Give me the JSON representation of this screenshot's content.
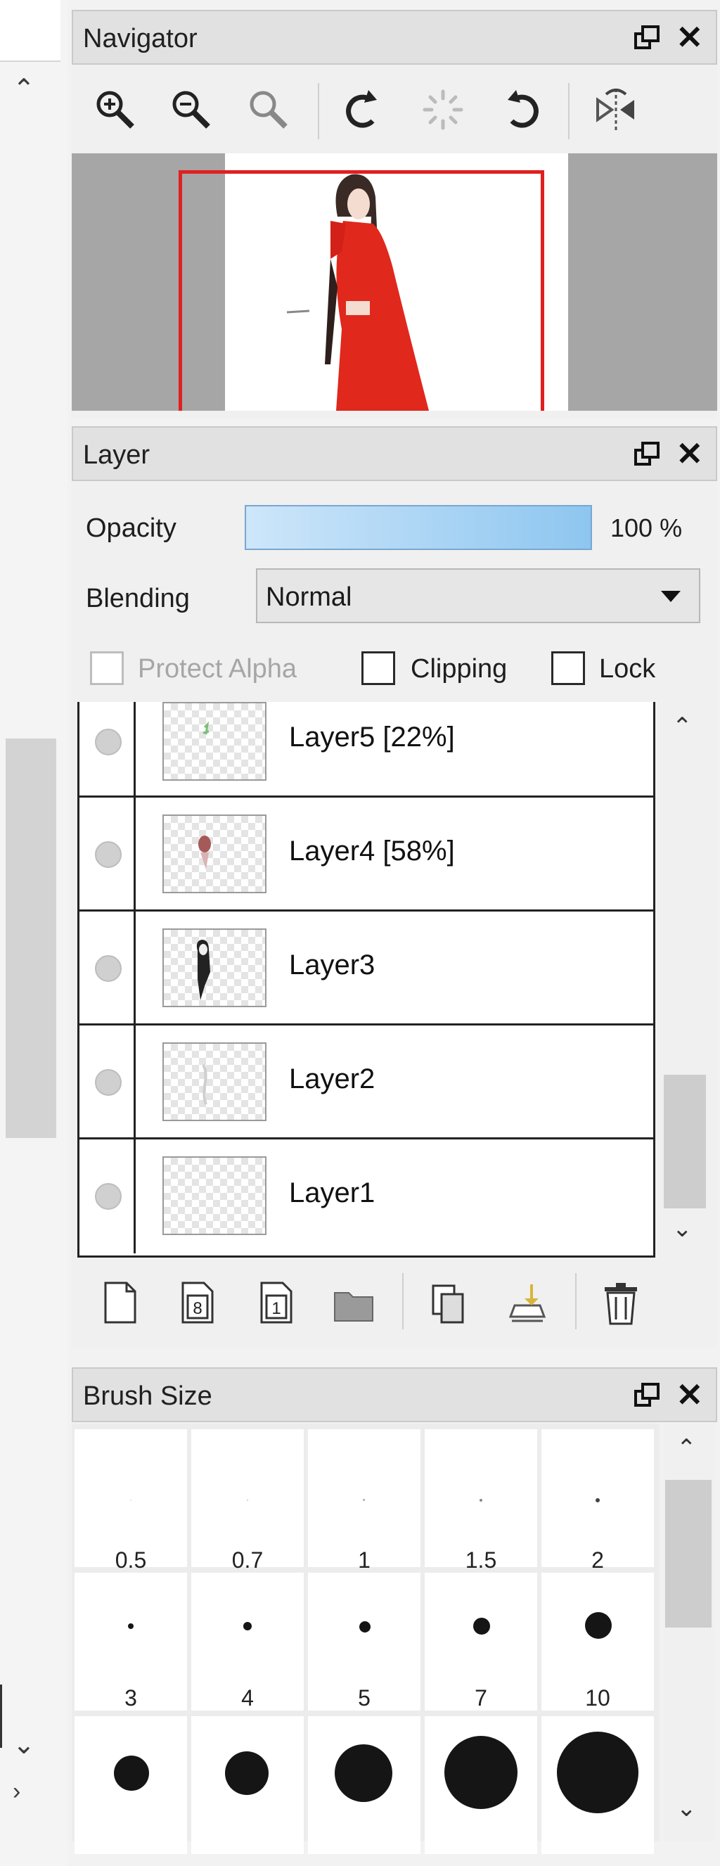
{
  "navigator": {
    "title": "Navigator",
    "tools": [
      "zoom-in-icon",
      "zoom-out-icon",
      "zoom-reset-icon",
      "rotate-left-icon",
      "rotate-reset-icon",
      "rotate-right-icon",
      "flip-horizontal-icon"
    ]
  },
  "layer": {
    "title": "Layer",
    "opacity_label": "Opacity",
    "opacity_value": "100 %",
    "opacity_fraction": 1.0,
    "blending_label": "Blending",
    "blending_value": "Normal",
    "protect_alpha_label": "Protect Alpha",
    "clipping_label": "Clipping",
    "lock_label": "Lock",
    "layers": [
      {
        "name": "Layer5 [22%]"
      },
      {
        "name": "Layer4 [58%]"
      },
      {
        "name": "Layer3"
      },
      {
        "name": "Layer2"
      },
      {
        "name": "Layer1"
      }
    ],
    "buttons": [
      "new-layer-icon",
      "new-8bit-layer-icon",
      "new-1bit-layer-icon",
      "new-folder-icon",
      "duplicate-layer-icon",
      "merge-down-icon",
      "delete-layer-icon"
    ]
  },
  "brush_size": {
    "title": "Brush Size",
    "sizes": [
      "0.5",
      "0.7",
      "1",
      "1.5",
      "2",
      "3",
      "4",
      "5",
      "7",
      "10"
    ],
    "colors": {
      "dot": "#151515"
    }
  },
  "colors": {
    "accent_red": "#e02020",
    "selection_blue": "#8ec6f0"
  }
}
